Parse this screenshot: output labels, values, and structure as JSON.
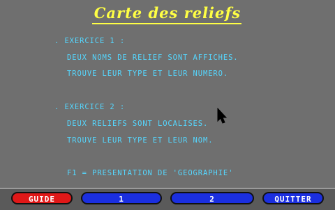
{
  "title": "Carte des reliefs",
  "exercise1": {
    "heading": ". EXERCICE 1 :",
    "line1": "DEUX NOMS DE RELIEF SONT AFFICHES.",
    "line2": "TROUVE LEUR TYPE ET LEUR NUMERO."
  },
  "exercise2": {
    "heading": ". EXERCICE 2 :",
    "line1": "DEUX RELIEFS SONT LOCALISES.",
    "line2": "TROUVE LEUR TYPE ET LEUR NOM."
  },
  "help_line": "F1 = PRESENTATION DE 'GEOGRAPHIE'",
  "buttons": {
    "guide": "GUIDE",
    "one": "1",
    "two": "2",
    "quit": "QUITTER"
  },
  "colors": {
    "background": "#6f6f6f",
    "title": "#ffff44",
    "text": "#55d7ff",
    "button_red": "#e01818",
    "button_blue": "#1b2fe0"
  },
  "icons": {
    "cursor": "mouse-pointer-icon"
  }
}
